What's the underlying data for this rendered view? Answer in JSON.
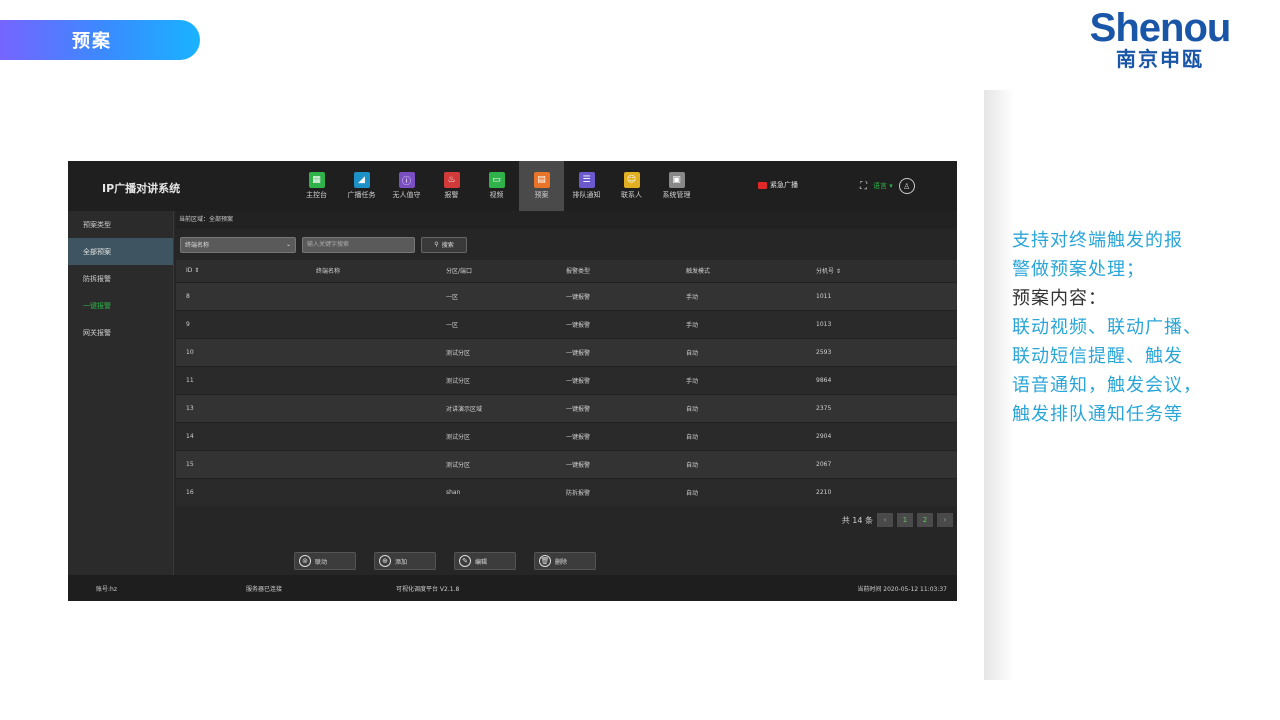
{
  "slide": {
    "title": "预案",
    "logo_en": "Shenou",
    "logo_cn": "南京申瓯",
    "desc_line1": "支持对终端触发的报",
    "desc_line2": "警做预案处理；",
    "desc_line3": "预案内容：",
    "desc_line4": "联动视频、联动广播、",
    "desc_line5": "联动短信提醒、触发",
    "desc_line6": "语音通知，触发会议，",
    "desc_line7": "触发排队通知任务等",
    "colors": {
      "accent": "#2aa5d8",
      "logo": "#1a56a8"
    }
  },
  "app": {
    "title": "IP广播对讲系统",
    "nav": [
      {
        "label": "主控台",
        "icon": "console-icon",
        "color": "#2fb24a"
      },
      {
        "label": "广播任务",
        "icon": "megaphone-icon",
        "color": "#1e90c8"
      },
      {
        "label": "无人值守",
        "icon": "info-icon",
        "color": "#7a4fc2"
      },
      {
        "label": "报警",
        "icon": "alarm-icon",
        "color": "#d23a3a"
      },
      {
        "label": "视频",
        "icon": "video-icon",
        "color": "#2fb24a"
      },
      {
        "label": "预案",
        "icon": "plan-icon",
        "color": "#e8742a"
      },
      {
        "label": "排队通知",
        "icon": "queue-icon",
        "color": "#6a5acd"
      },
      {
        "label": "联系人",
        "icon": "contacts-icon",
        "color": "#e0b020"
      },
      {
        "label": "系统管理",
        "icon": "settings-icon",
        "color": "#888888"
      }
    ],
    "emergency": "紧急广播",
    "lang": "语言",
    "sidebar": [
      {
        "label": "预案类型"
      },
      {
        "label": "全部预案"
      },
      {
        "label": "防拆报警"
      },
      {
        "label": "一键报警"
      },
      {
        "label": "网关报警"
      }
    ],
    "crumb": "当前区域：全部预案",
    "filter_select": "终端名称",
    "filter_placeholder": "输入关键字搜索",
    "search_label": "搜索",
    "columns": [
      "ID ⇕",
      "终端名称",
      "分区/端口",
      "报警类型",
      "触发模式",
      "分机号 ⇕"
    ],
    "rows": [
      [
        "8",
        "",
        "一区",
        "一键报警",
        "手动",
        "1011"
      ],
      [
        "9",
        "",
        "一区",
        "一键报警",
        "手动",
        "1013"
      ],
      [
        "10",
        "",
        "测试分区",
        "一键报警",
        "自动",
        "2593"
      ],
      [
        "11",
        "",
        "测试分区",
        "一键报警",
        "手动",
        "9864"
      ],
      [
        "13",
        "",
        "对讲演示区域",
        "一键报警",
        "自动",
        "2375"
      ],
      [
        "14",
        "",
        "测试分区",
        "一键报警",
        "自动",
        "2904"
      ],
      [
        "15",
        "",
        "测试分区",
        "一键报警",
        "自动",
        "2067"
      ],
      [
        "16",
        "",
        "shan",
        "防拆报警",
        "自动",
        "2210"
      ]
    ],
    "pager": {
      "total": "共 14 条",
      "prev": "‹",
      "page1": "1",
      "page2": "2",
      "next": "›"
    },
    "actions": [
      {
        "label": "联动",
        "icon": "link-icon"
      },
      {
        "label": "添加",
        "icon": "add-icon"
      },
      {
        "label": "编辑",
        "icon": "edit-icon"
      },
      {
        "label": "删除",
        "icon": "delete-icon"
      }
    ],
    "status": {
      "account": "账号:hz",
      "conn": "服务器已连接",
      "platform": "可视化调度平台  V2.1.8",
      "time": "当前时间 2020-05-12 11:03:37"
    }
  }
}
